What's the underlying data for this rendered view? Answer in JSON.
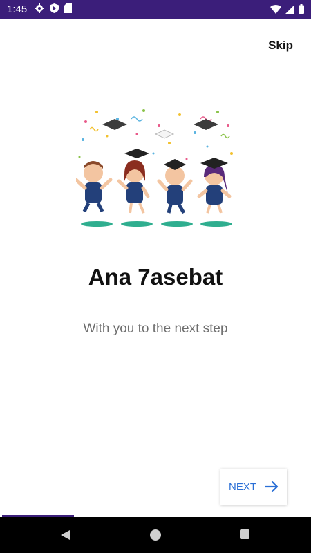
{
  "status_bar": {
    "time": "1:45",
    "left_icons": [
      "gear-icon",
      "shield-play-icon",
      "sd-card-icon"
    ],
    "right_icons": [
      "wifi-icon",
      "signal-icon",
      "battery-icon"
    ]
  },
  "onboarding": {
    "skip_label": "Skip",
    "illustration": "graduation-kids-illustration",
    "title": "Ana 7asebat",
    "subtitle": "With you to the next step",
    "next_label": "NEXT",
    "next_icon": "arrow-right-icon",
    "page_index": 1
  },
  "nav_bar": {
    "icons": [
      "back-icon",
      "home-icon",
      "recents-icon"
    ]
  },
  "colors": {
    "status_bar": "#3b1e7a",
    "accent": "#2a6fd6",
    "title": "#111111",
    "subtitle": "#6e6e6e"
  }
}
